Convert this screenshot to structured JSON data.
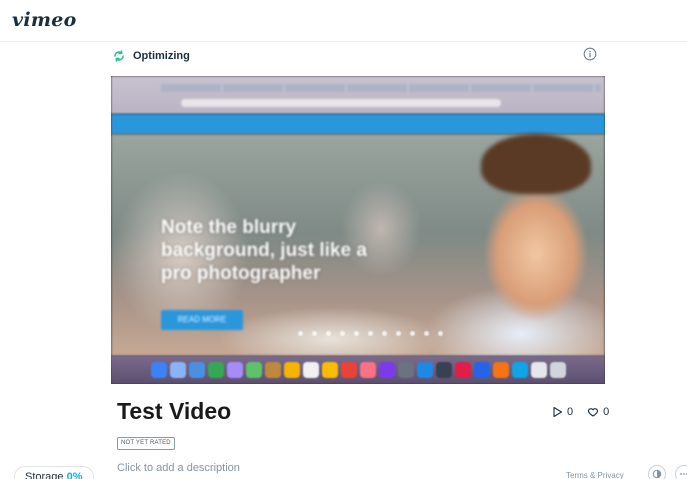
{
  "app": {
    "logo": "vimeo"
  },
  "status": {
    "label": "Optimizing",
    "icon": "sync-icon"
  },
  "player": {
    "headline": "Note the blurry background, just like a pro photographer",
    "cta": "READ MORE",
    "slide_count": 11,
    "dock_colors": [
      "#3b82f6",
      "#8ab4f8",
      "#4a90e2",
      "#34a853",
      "#a78bfa",
      "#5ec26a",
      "#c0883c",
      "#f4b400",
      "#f0f0f0",
      "#fbbc04",
      "#ea4335",
      "#fb7185",
      "#7c3aed",
      "#6b7280",
      "#1e88e5",
      "#374151",
      "#e11d48",
      "#2563eb",
      "#f97316",
      "#0ea5e9",
      "#e5e7eb",
      "#d1d5db"
    ]
  },
  "video": {
    "title": "Test Video",
    "plays": "0",
    "likes": "0",
    "rating": "NOT YET RATED",
    "description_placeholder": "Click to add a description"
  },
  "storage": {
    "label": "Storage",
    "percent": "0%"
  },
  "footer": {
    "terms": "Terms & Privacy"
  },
  "colors": {
    "accent": "#0bb3ed",
    "status_icon": "#27c08a",
    "nav_blue": "#2a97dd"
  }
}
